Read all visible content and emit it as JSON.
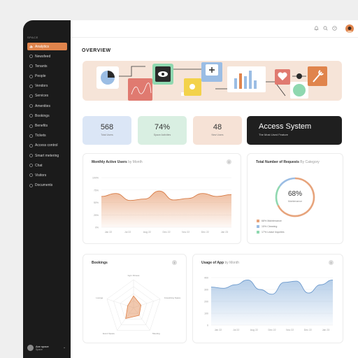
{
  "sidebar": {
    "brand": "SPACE",
    "items": [
      {
        "label": "Analytics",
        "icon": "chart-icon",
        "active": true
      },
      {
        "label": "Newsfeed",
        "icon": "newsfeed-icon"
      },
      {
        "label": "Tenants",
        "icon": "tenants-icon"
      },
      {
        "label": "People",
        "icon": "people-icon"
      },
      {
        "label": "Vendors",
        "icon": "vendors-icon"
      },
      {
        "label": "Services",
        "icon": "services-icon"
      },
      {
        "label": "Amenities",
        "icon": "amenities-icon"
      },
      {
        "label": "Bookings",
        "icon": "bookings-icon"
      },
      {
        "label": "Benefits",
        "icon": "benefits-icon"
      },
      {
        "label": "Tickets",
        "icon": "tickets-icon"
      },
      {
        "label": "Access control",
        "icon": "access-icon"
      },
      {
        "label": "Smart metering",
        "icon": "metering-icon"
      },
      {
        "label": "Chat",
        "icon": "chat-icon"
      },
      {
        "label": "Visitors",
        "icon": "visitors-icon"
      },
      {
        "label": "Documents",
        "icon": "documents-icon"
      }
    ],
    "user": {
      "name": "Axe space",
      "role": "Space"
    }
  },
  "header": {
    "title": "OVERVIEW"
  },
  "stats": [
    {
      "value": "568",
      "label": "Total Users",
      "color": "#dbe6f6"
    },
    {
      "value": "74%",
      "label": "Space Activities",
      "color": "#d9efe2"
    },
    {
      "value": "48",
      "label": "New Users",
      "color": "#f6e2d6"
    }
  ],
  "access": {
    "title": "Access System",
    "subtitle": "The Most Used Feature"
  },
  "monthly_users": {
    "title": "Monthly Active Users",
    "by": "by Month"
  },
  "requests": {
    "title": "Total Number of Requests",
    "by": "By Category",
    "center_value": "68%",
    "center_label": "Maintenance",
    "legend": [
      {
        "label": "68% Maintenance",
        "color": "#e7a47c"
      },
      {
        "label": "15% Cleaning",
        "color": "#9bbde4"
      },
      {
        "label": "17% Lease Inquiries",
        "color": "#8fd8b0"
      }
    ]
  },
  "bookings": {
    "title": "Bookings"
  },
  "usage": {
    "title": "Usage of App",
    "by": "by Month"
  },
  "chart_data": [
    {
      "type": "area",
      "title": "Monthly Active Users by Month",
      "categories": [
        "Jan 22",
        "Jul 22",
        "Aug 22",
        "Dec 22",
        "Nov 22",
        "Dec 22",
        "Jan 23"
      ],
      "y_ticks": [
        "100%",
        "75%",
        "50%",
        "25%",
        "0%"
      ],
      "values": [
        62,
        68,
        54,
        57,
        73,
        55,
        58,
        68,
        62,
        66
      ],
      "ylim": [
        0,
        100
      ],
      "color": "#e0844c",
      "grid": true
    },
    {
      "type": "pie",
      "title": "Total Number of Requests By Category",
      "categories": [
        "Maintenance",
        "Cleaning",
        "Lease Inquiries"
      ],
      "values": [
        68,
        15,
        17
      ]
    },
    {
      "type": "radar",
      "title": "Bookings",
      "axes": [
        "Gym Fitness",
        "Coworking Space",
        "Meeting",
        "Event Space",
        "Lounge"
      ],
      "values": [
        0.42,
        0.28,
        0.34,
        0.48,
        0.22
      ],
      "color": "#e0844c"
    },
    {
      "type": "area",
      "title": "Usage of App by Month",
      "categories": [
        "Jan 22",
        "Jul 22",
        "Aug 22",
        "Dec 22",
        "Nov 22",
        "Dec 22",
        "Jan 23"
      ],
      "y_ticks": [
        "400",
        "300",
        "200",
        "100",
        "0"
      ],
      "values": [
        320,
        310,
        340,
        380,
        300,
        260,
        360,
        370,
        270,
        340,
        380
      ],
      "ylim": [
        0,
        400
      ],
      "color": "#7aa6d6",
      "grid": true
    }
  ]
}
